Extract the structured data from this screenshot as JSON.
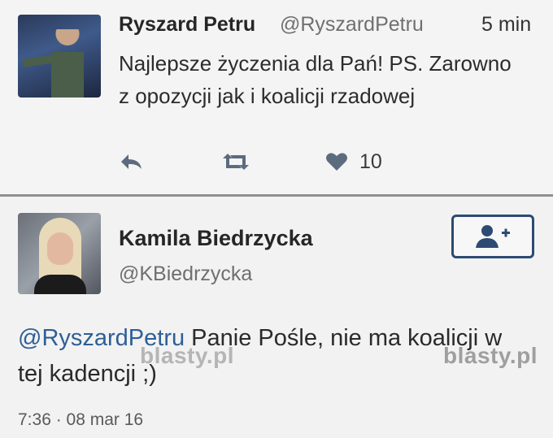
{
  "tweet1": {
    "name": "Ryszard Petru",
    "handle": "@RyszardPetru",
    "time": "5 min",
    "text": "Najlepsze życzenia dla Pań! PS. Zarowno z opozycji jak i koalicji rzadowej",
    "like_count": "10",
    "icons": {
      "reply": "reply-icon",
      "retweet": "retweet-icon",
      "like": "heart-icon"
    }
  },
  "tweet2": {
    "name": "Kamila Biedrzycka",
    "handle": "@KBiedrzycka",
    "mention": "@RyszardPetru",
    "text": " Panie Pośle, nie ma koalicji w tej kadencji ;)",
    "date": "7:36 · 08 mar 16",
    "follow_icon": "add-user-icon"
  },
  "watermarks": [
    "blasty.pl",
    "blasty.pl"
  ],
  "colors": {
    "link": "#2e5f96",
    "follow_border": "#2d4a72",
    "divider": "#8f8f8f"
  }
}
